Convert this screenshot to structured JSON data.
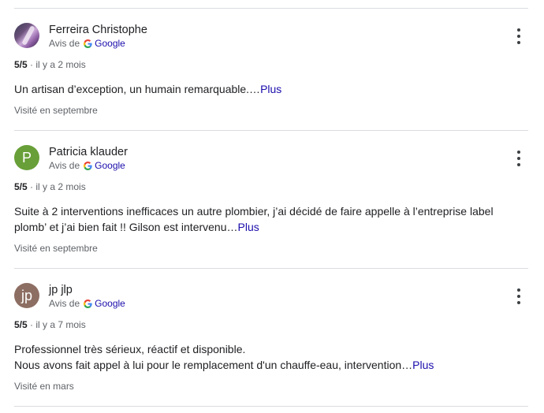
{
  "reviews": [
    {
      "author": "Ferreira Christophe",
      "avatar_letter": "",
      "avatar_color": "#6a4f7a",
      "source_prefix": "Avis de",
      "source_name": "Google",
      "rating": "5/5",
      "separator": "·",
      "date": "il y a 2 mois",
      "text_lines": [
        "Un artisan d’exception, un humain remarquable.…"
      ],
      "more_label": "Plus",
      "visited": "Visité en septembre"
    },
    {
      "author": "Patricia klauder",
      "avatar_letter": "P",
      "avatar_color": "#689f38",
      "source_prefix": "Avis de",
      "source_name": "Google",
      "rating": "5/5",
      "separator": "·",
      "date": "il y a 2 mois",
      "text_lines": [
        "Suite à 2 interventions inefficaces un autre plombier, j’ai décidé de faire appelle à l’entreprise label",
        "plomb’ et j’ai bien fait !! Gilson est intervenu…"
      ],
      "more_label": "Plus",
      "visited": "Visité en septembre"
    },
    {
      "author": "jp jlp",
      "avatar_letter": "jp",
      "avatar_color": "#8d6e63",
      "source_prefix": "Avis de",
      "source_name": "Google",
      "rating": "5/5",
      "separator": "·",
      "date": "il y a 7 mois",
      "text_lines": [
        "Professionnel très sérieux, réactif et disponible.",
        "Nous avons fait appel à lui pour le remplacement d'un chauffe-eau, intervention…"
      ],
      "more_label": "Plus",
      "visited": "Visité en mars"
    }
  ],
  "icons": {
    "google": "google-g-icon",
    "menu": "more-vert-icon"
  }
}
